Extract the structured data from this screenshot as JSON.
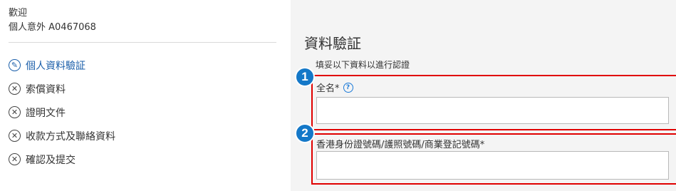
{
  "sidebar": {
    "welcome": "歡迎",
    "account": "個人意外 A0467068",
    "steps": [
      {
        "label": "個人資料驗証",
        "icon": "pencil-icon",
        "active": true
      },
      {
        "label": "索償資料",
        "icon": "x-circle-icon",
        "active": false
      },
      {
        "label": "證明文件",
        "icon": "x-circle-icon",
        "active": false
      },
      {
        "label": "收款方式及聯絡資料",
        "icon": "x-circle-icon",
        "active": false
      },
      {
        "label": "確認及提交",
        "icon": "x-circle-icon",
        "active": false
      }
    ]
  },
  "main": {
    "title": "資料驗証",
    "subtitle": "填妥以下資料以進行認證",
    "fields": [
      {
        "badge": "1",
        "label": "全名*",
        "value": "",
        "help_icon": "question-icon"
      },
      {
        "badge": "2",
        "label": "香港身份證號碼/護照號碼/商業登記號碼*",
        "value": ""
      }
    ]
  },
  "colors": {
    "accent": "#1b5faa",
    "badge": "#1478c8",
    "highlight": "#e00000"
  }
}
